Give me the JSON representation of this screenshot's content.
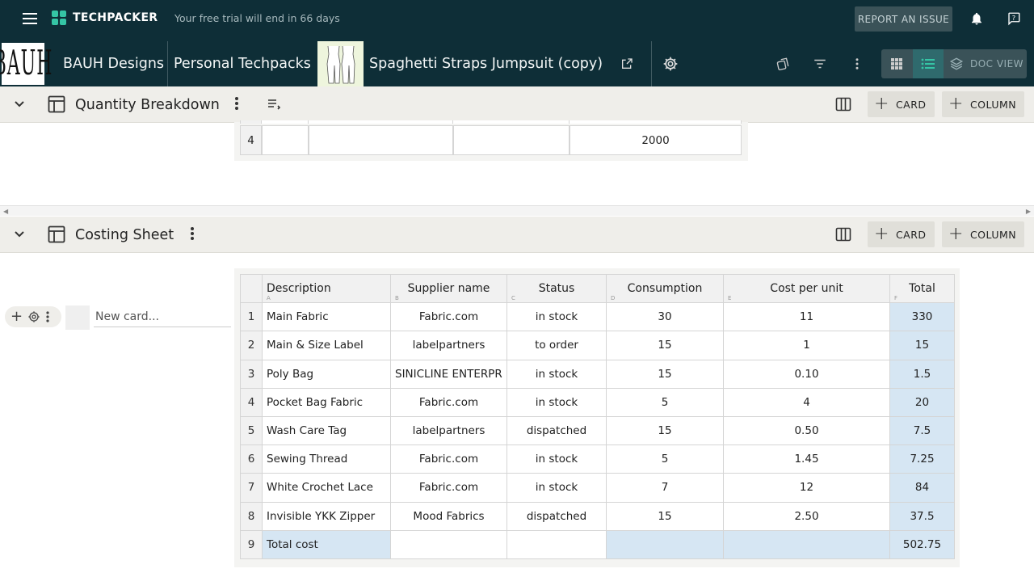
{
  "topbar": {
    "logo_text": "TECHPACKER",
    "trial_text": "Your free trial will end in 66 days",
    "report_label": "REPORT AN ISSUE"
  },
  "breadcrumb": {
    "brand_logo_text": "BAUH",
    "company": "BAUH Designs",
    "folder": "Personal Techpacks",
    "product": "Spaghetti Straps Jumpsuit (copy)",
    "doc_view_label": "DOC VIEW"
  },
  "quantity_section": {
    "title": "Quantity Breakdown",
    "card_label": "CARD",
    "column_label": "COLUMN",
    "visible_row": {
      "num": "4",
      "cells": [
        "",
        "",
        "",
        "2000"
      ]
    }
  },
  "costing_section": {
    "title": "Costing Sheet",
    "card_label": "CARD",
    "column_label": "COLUMN",
    "new_card_placeholder": "New card...",
    "headers": [
      {
        "label": "Description",
        "letter": "A"
      },
      {
        "label": "Supplier name",
        "letter": "B"
      },
      {
        "label": "Status",
        "letter": "C"
      },
      {
        "label": "Consumption",
        "letter": "D"
      },
      {
        "label": "Cost per unit",
        "letter": "E"
      },
      {
        "label": "Total",
        "letter": "F"
      }
    ],
    "rows": [
      {
        "num": "1",
        "description": "Main Fabric",
        "supplier": "Fabric.com",
        "status": "in stock",
        "consumption": "30",
        "cost": "11",
        "total": "330"
      },
      {
        "num": "2",
        "description": "Main & Size Label",
        "supplier": "labelpartners",
        "status": "to order",
        "consumption": "15",
        "cost": "1",
        "total": "15"
      },
      {
        "num": "3",
        "description": "Poly Bag",
        "supplier": "SINICLINE ENTERPR",
        "status": "in stock",
        "consumption": "15",
        "cost": "0.10",
        "total": "1.5"
      },
      {
        "num": "4",
        "description": "Pocket Bag Fabric",
        "supplier": "Fabric.com",
        "status": "in stock",
        "consumption": "5",
        "cost": "4",
        "total": "20"
      },
      {
        "num": "5",
        "description": "Wash Care Tag",
        "supplier": "labelpartners",
        "status": "dispatched",
        "consumption": "15",
        "cost": "0.50",
        "total": "7.5"
      },
      {
        "num": "6",
        "description": "Sewing Thread",
        "supplier": "Fabric.com",
        "status": "in stock",
        "consumption": "5",
        "cost": "1.45",
        "total": "7.25"
      },
      {
        "num": "7",
        "description": "White Crochet Lace",
        "supplier": "Fabric.com",
        "status": "in stock",
        "consumption": "7",
        "cost": "12",
        "total": "84"
      },
      {
        "num": "8",
        "description": "Invisible YKK Zipper",
        "supplier": "Mood Fabrics",
        "status": "dispatched",
        "consumption": "15",
        "cost": "2.50",
        "total": "37.5"
      }
    ],
    "total_row": {
      "num": "9",
      "label": "Total cost",
      "total": "502.75"
    }
  },
  "colors": {
    "topbar_bg": "#0e2e37",
    "accent": "#35c5a5",
    "header_bg": "#efeeea",
    "formula_cell": "#d6e6f3"
  }
}
